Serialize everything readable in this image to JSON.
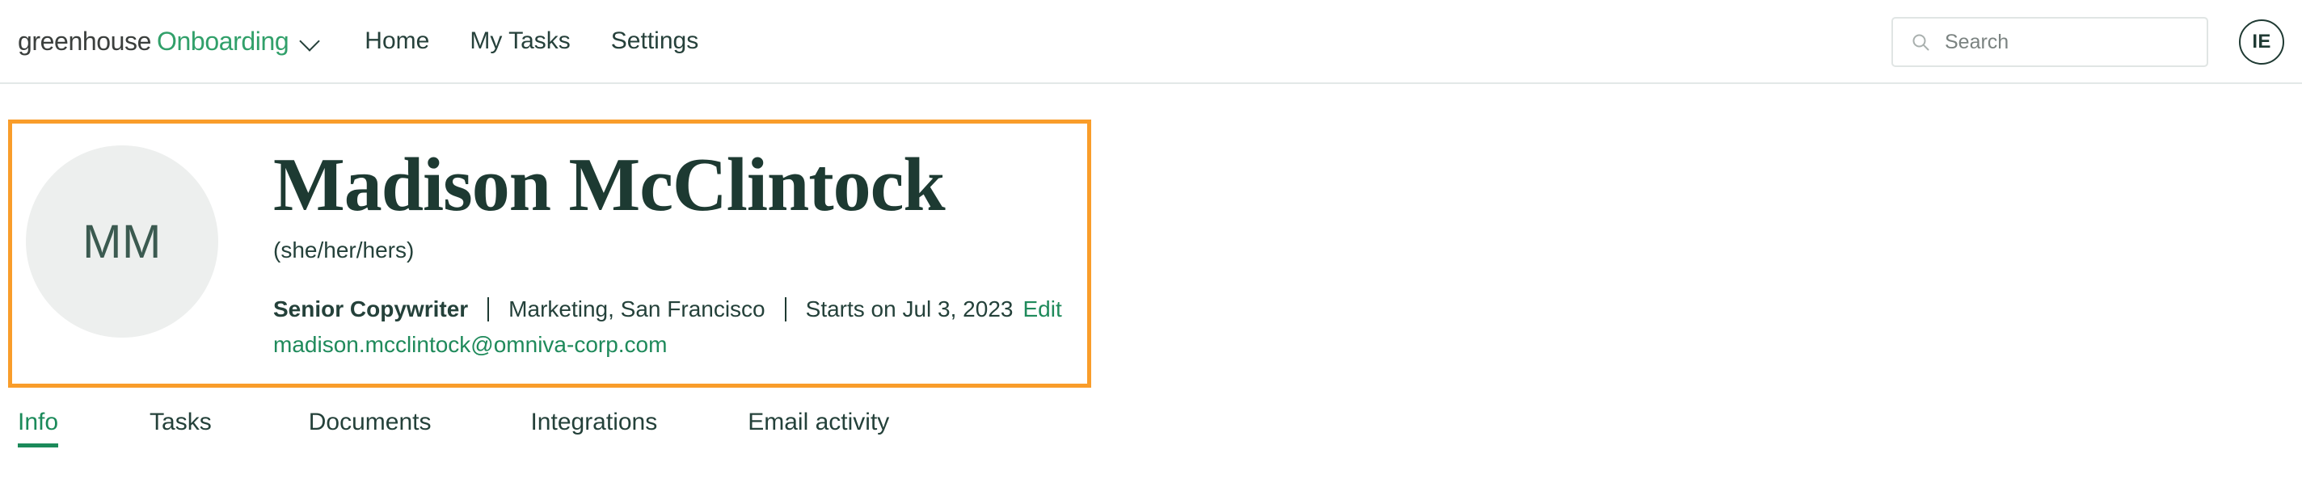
{
  "colors": {
    "brand_green": "#31a06a",
    "dark_green": "#24413a",
    "link_green": "#1f8a5b",
    "active_tab": "#1b8a5a",
    "highlight_orange": "#f99d2a",
    "avatar_bg": "#edefee",
    "border_gray": "#e3e8e7"
  },
  "topbar": {
    "brand": {
      "company": "greenhouse",
      "product": "Onboarding",
      "chevron_icon": "chevron-down-icon"
    },
    "nav_links": [
      {
        "label": "Home"
      },
      {
        "label": "My Tasks"
      },
      {
        "label": "Settings"
      }
    ],
    "search": {
      "icon": "search-icon",
      "placeholder": "Search",
      "value": ""
    },
    "user_avatar": {
      "initials": "IE"
    }
  },
  "profile": {
    "avatar_initials": "MM",
    "name": "Madison McClintock",
    "pronouns": "(she/her/hers)",
    "meta": {
      "job_title": "Senior Copywriter",
      "department_location": "Marketing, San Francisco",
      "start_date": "Starts on Jul 3, 2023",
      "edit_label": "Edit"
    },
    "email": "madison.mcclintock@omniva-corp.com"
  },
  "tabs": [
    {
      "label": "Info",
      "active": true
    },
    {
      "label": "Tasks",
      "active": false
    },
    {
      "label": "Documents",
      "active": false
    },
    {
      "label": "Integrations",
      "active": false
    },
    {
      "label": "Email activity",
      "active": false
    }
  ]
}
